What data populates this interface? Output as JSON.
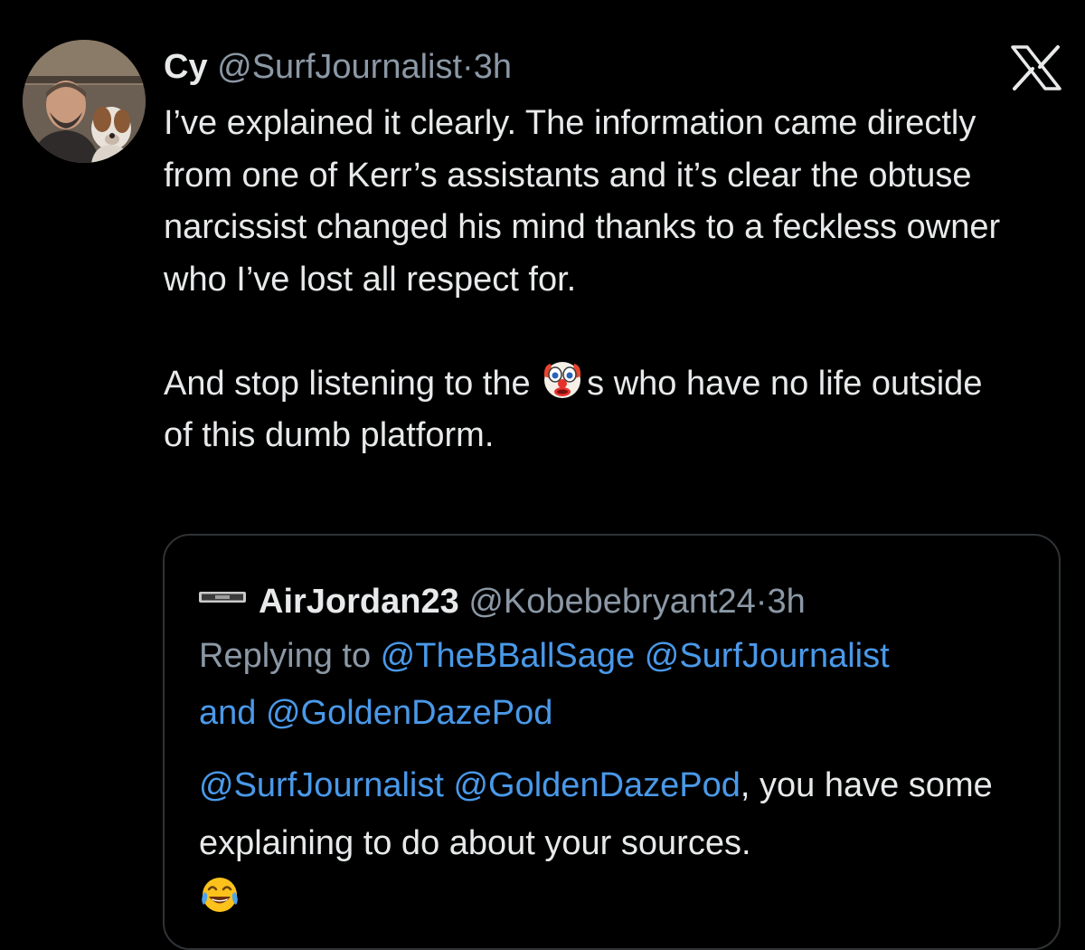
{
  "post": {
    "display_name": "Cy",
    "handle": "@SurfJournalist",
    "separator": "·",
    "time": "3h",
    "text_line1": "I’ve explained it clearly. The information came directly from one of Kerr’s assistants and it’s clear the obtuse narcissist changed his mind thanks to a feckless owner who I’ve lost all respect for.",
    "text_line2_before": "And stop listening to the ",
    "text_line2_emoji": "clown-face-emoji",
    "text_line2_after": "s who have no life outside of this dumb platform."
  },
  "quoted_post": {
    "display_name": "AirJordan23",
    "handle": "@Kobebebryant24",
    "separator": "·",
    "time": "3h",
    "replying_prefix": "Replying to ",
    "replying_mention1": "@TheBBallSage",
    "replying_mention2": "@SurfJournalist",
    "replying_and": "and ",
    "replying_mention3": "@GoldenDazePod",
    "text_mention1": "@SurfJournalist",
    "text_mention2": "@GoldenDazePod",
    "text_rest": ", you have some explaining to do about your sources.",
    "text_emoji": "tears-of-joy-emoji"
  },
  "icons": {
    "brand": "x-logo-icon"
  },
  "colors": {
    "background": "#000000",
    "text": "#e7e9ea",
    "secondary": "#8b98a5",
    "link": "#4a99e9",
    "border": "#2f3336"
  }
}
